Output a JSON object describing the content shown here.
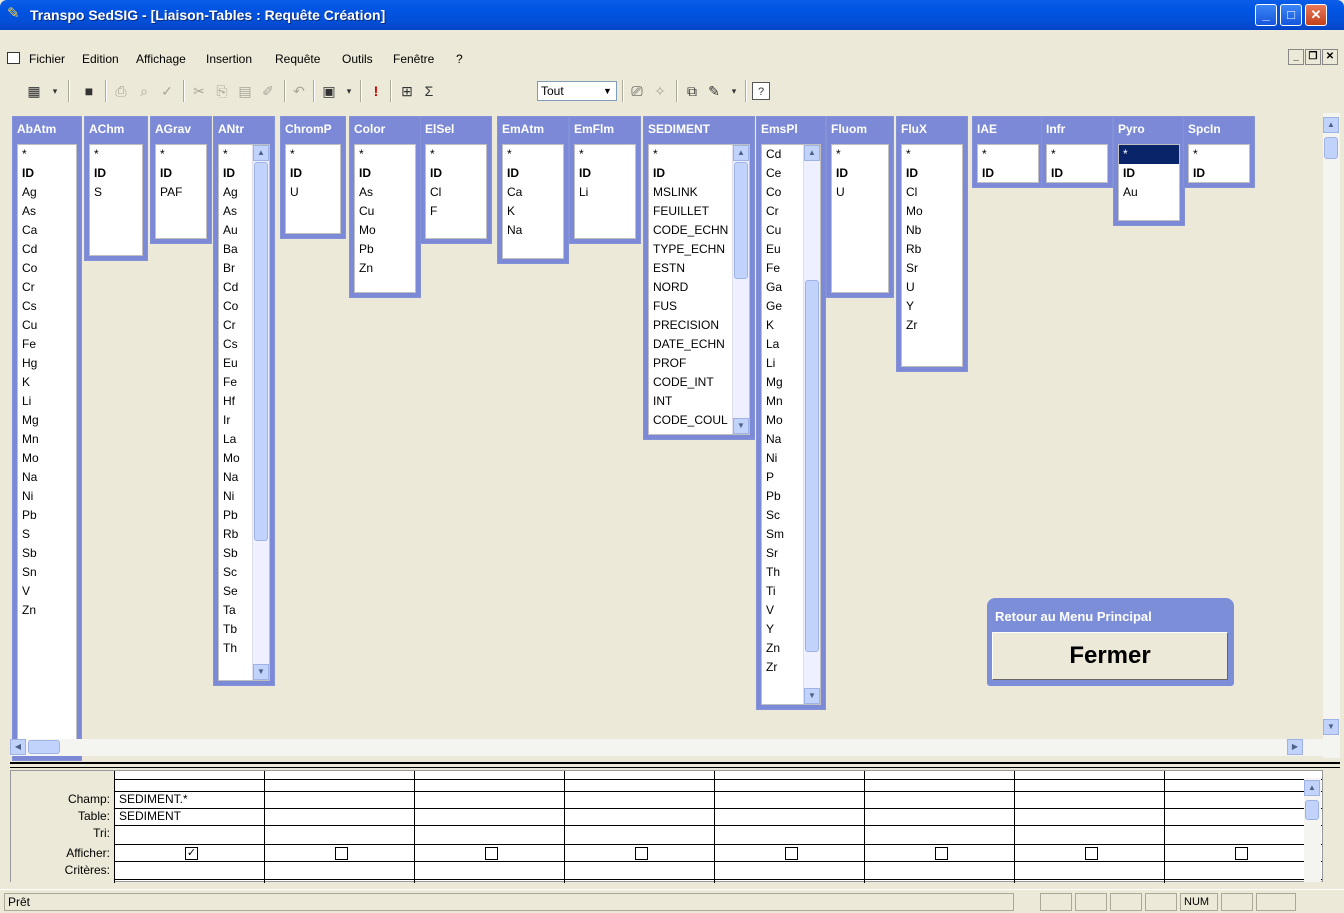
{
  "window": {
    "title": "Transpo SedSIG - [Liaison-Tables : Requête Création]"
  },
  "menu": [
    "Fichier",
    "Edition",
    "Affichage",
    "Insertion",
    "Requête",
    "Outils",
    "Fenêtre",
    "?"
  ],
  "toolbar": {
    "combo_value": "Tout"
  },
  "tables": [
    {
      "name": "AbAtm",
      "fields": [
        "*",
        "ID",
        "Ag",
        "As",
        "Ca",
        "Cd",
        "Co",
        "Cr",
        "Cs",
        "Cu",
        "Fe",
        "Hg",
        "K",
        "Li",
        "Mg",
        "Mn",
        "Mo",
        "Na",
        "Ni",
        "Pb",
        "S",
        "Sb",
        "Sn",
        "V",
        "Zn"
      ]
    },
    {
      "name": "AChm",
      "fields": [
        "*",
        "ID",
        "S"
      ]
    },
    {
      "name": "AGrav",
      "fields": [
        "*",
        "ID",
        "PAF"
      ]
    },
    {
      "name": "ANtr",
      "fields": [
        "*",
        "ID",
        "Ag",
        "As",
        "Au",
        "Ba",
        "Br",
        "Cd",
        "Co",
        "Cr",
        "Cs",
        "Eu",
        "Fe",
        "Hf",
        "Ir",
        "La",
        "Mo",
        "Na",
        "Ni",
        "Pb",
        "Rb",
        "Sb",
        "Sc",
        "Se",
        "Ta",
        "Tb",
        "Th"
      ]
    },
    {
      "name": "ChromP",
      "fields": [
        "*",
        "ID",
        "U"
      ]
    },
    {
      "name": "Color",
      "fields": [
        "*",
        "ID",
        "As",
        "Cu",
        "Mo",
        "Pb",
        "Zn"
      ]
    },
    {
      "name": "ElSel",
      "fields": [
        "*",
        "ID",
        "Cl",
        "F"
      ]
    },
    {
      "name": "EmAtm",
      "fields": [
        "*",
        "ID",
        "Ca",
        "K",
        "Na"
      ]
    },
    {
      "name": "EmFlm",
      "fields": [
        "*",
        "ID",
        "Li"
      ]
    },
    {
      "name": "SEDIMENT",
      "fields": [
        "*",
        "ID",
        "MSLINK",
        "FEUILLET",
        "CODE_ECHN",
        "TYPE_ECHN",
        "ESTN",
        "NORD",
        "FUS",
        "PRECISION",
        "DATE_ECHN",
        "PROF",
        "CODE_INT",
        "INT",
        "CODE_COUL"
      ]
    },
    {
      "name": "EmsPl",
      "fields": [
        "Cd",
        "Ce",
        "Co",
        "Cr",
        "Cu",
        "Eu",
        "Fe",
        "Ga",
        "Ge",
        "K",
        "La",
        "Li",
        "Mg",
        "Mn",
        "Mo",
        "Na",
        "Ni",
        "P",
        "Pb",
        "Sc",
        "Sm",
        "Sr",
        "Th",
        "Ti",
        "V",
        "Y",
        "Zn",
        "Zr"
      ]
    },
    {
      "name": "Fluom",
      "fields": [
        "*",
        "ID",
        "U"
      ]
    },
    {
      "name": "FluX",
      "fields": [
        "*",
        "ID",
        "Cl",
        "Mo",
        "Nb",
        "Rb",
        "Sr",
        "U",
        "Y",
        "Zr"
      ]
    },
    {
      "name": "IAE",
      "fields": [
        "*",
        "ID"
      ]
    },
    {
      "name": "Infr",
      "fields": [
        "*",
        "ID"
      ]
    },
    {
      "name": "Pyro",
      "fields": [
        "*",
        "ID",
        "Au"
      ]
    },
    {
      "name": "SpcIn",
      "fields": [
        "*",
        "ID"
      ]
    }
  ],
  "fermer": {
    "label": "Retour au Menu Principal",
    "button": "Fermer"
  },
  "grid": {
    "row_labels": [
      "Champ:",
      "Table:",
      "Tri:",
      "Afficher:",
      "Critères:"
    ],
    "columns": [
      {
        "champ": "SEDIMENT.*",
        "table": "SEDIMENT",
        "afficher": true
      },
      {
        "champ": "",
        "table": "",
        "afficher": false
      },
      {
        "champ": "",
        "table": "",
        "afficher": false
      },
      {
        "champ": "",
        "table": "",
        "afficher": false
      },
      {
        "champ": "",
        "table": "",
        "afficher": false
      },
      {
        "champ": "",
        "table": "",
        "afficher": false
      },
      {
        "champ": "",
        "table": "",
        "afficher": false
      },
      {
        "champ": "",
        "table": "",
        "afficher": false
      }
    ]
  },
  "status": {
    "text": "Prêt",
    "num": "NUM"
  }
}
